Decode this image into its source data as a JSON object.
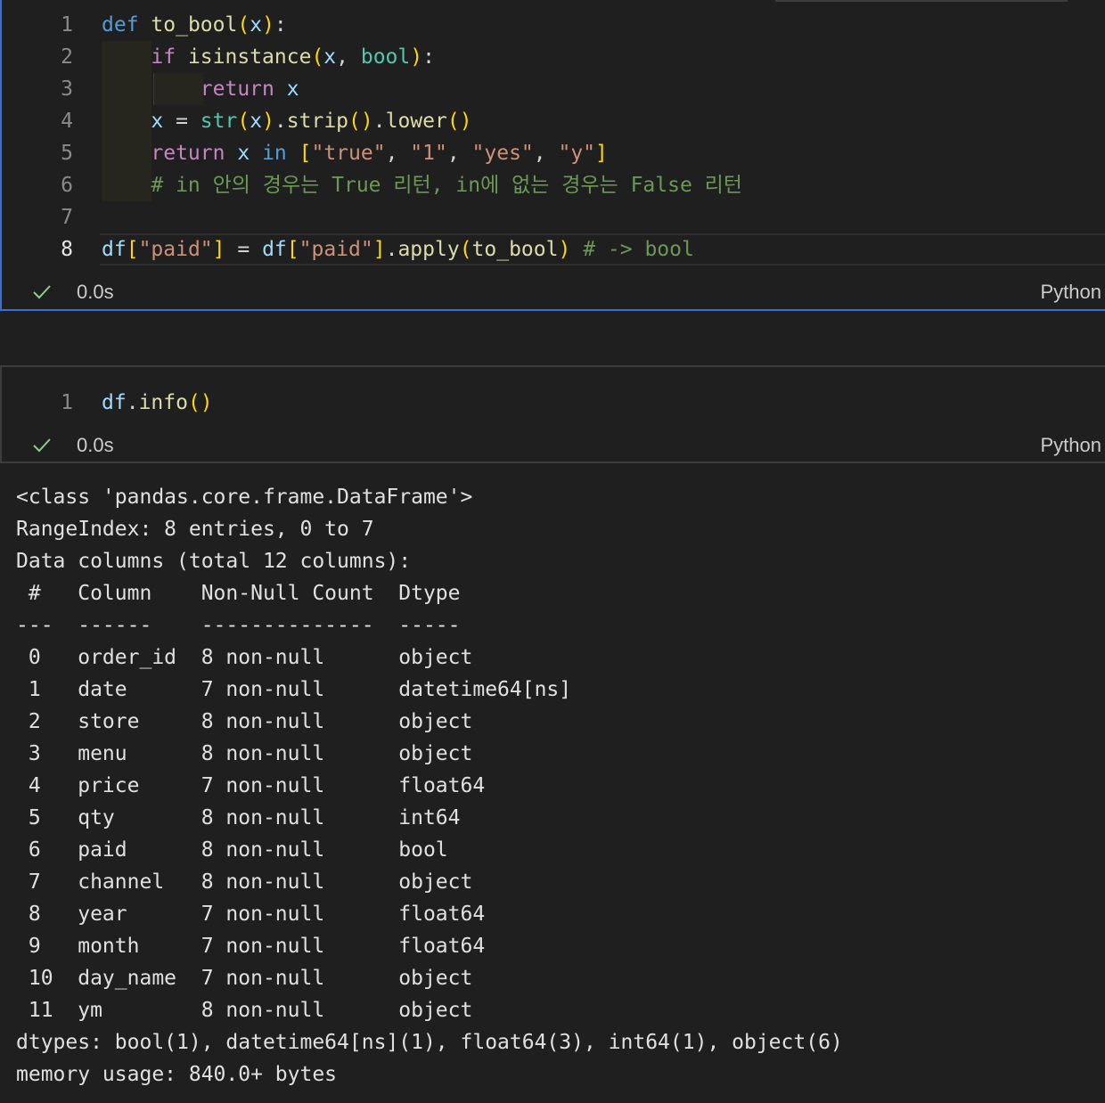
{
  "cell1": {
    "lines": [
      {
        "num": "1",
        "tokens": [
          {
            "t": "def",
            "c": "kw"
          },
          {
            "t": " ",
            "c": "op"
          },
          {
            "t": "to_bool",
            "c": "fn"
          },
          {
            "t": "(",
            "c": "br1"
          },
          {
            "t": "x",
            "c": "var"
          },
          {
            "t": ")",
            "c": "br1"
          },
          {
            "t": ":",
            "c": "op"
          }
        ]
      },
      {
        "num": "2",
        "tokens": [
          {
            "t": "    ",
            "c": "op"
          },
          {
            "t": "if",
            "c": "ctl"
          },
          {
            "t": " ",
            "c": "op"
          },
          {
            "t": "isinstance",
            "c": "fn"
          },
          {
            "t": "(",
            "c": "br1"
          },
          {
            "t": "x",
            "c": "var"
          },
          {
            "t": ", ",
            "c": "op"
          },
          {
            "t": "bool",
            "c": "cls"
          },
          {
            "t": ")",
            "c": "br1"
          },
          {
            "t": ":",
            "c": "op"
          }
        ]
      },
      {
        "num": "3",
        "tokens": [
          {
            "t": "        ",
            "c": "op"
          },
          {
            "t": "return",
            "c": "ctl"
          },
          {
            "t": " ",
            "c": "op"
          },
          {
            "t": "x",
            "c": "var"
          }
        ]
      },
      {
        "num": "4",
        "tokens": [
          {
            "t": "    ",
            "c": "op"
          },
          {
            "t": "x",
            "c": "var"
          },
          {
            "t": " = ",
            "c": "op"
          },
          {
            "t": "str",
            "c": "cls"
          },
          {
            "t": "(",
            "c": "br1"
          },
          {
            "t": "x",
            "c": "var"
          },
          {
            "t": ")",
            "c": "br1"
          },
          {
            "t": ".",
            "c": "op"
          },
          {
            "t": "strip",
            "c": "fn"
          },
          {
            "t": "()",
            "c": "br1"
          },
          {
            "t": ".",
            "c": "op"
          },
          {
            "t": "lower",
            "c": "fn"
          },
          {
            "t": "()",
            "c": "br1"
          }
        ]
      },
      {
        "num": "5",
        "tokens": [
          {
            "t": "    ",
            "c": "op"
          },
          {
            "t": "return",
            "c": "ctl"
          },
          {
            "t": " ",
            "c": "op"
          },
          {
            "t": "x",
            "c": "var"
          },
          {
            "t": " ",
            "c": "op"
          },
          {
            "t": "in",
            "c": "kw"
          },
          {
            "t": " ",
            "c": "op"
          },
          {
            "t": "[",
            "c": "br1"
          },
          {
            "t": "\"true\"",
            "c": "str"
          },
          {
            "t": ", ",
            "c": "op"
          },
          {
            "t": "\"1\"",
            "c": "str"
          },
          {
            "t": ", ",
            "c": "op"
          },
          {
            "t": "\"yes\"",
            "c": "str"
          },
          {
            "t": ", ",
            "c": "op"
          },
          {
            "t": "\"y\"",
            "c": "str"
          },
          {
            "t": "]",
            "c": "br1"
          }
        ]
      },
      {
        "num": "6",
        "tokens": [
          {
            "t": "    ",
            "c": "op"
          },
          {
            "t": "# in 안의 경우는 True 리턴, in에 없는 경우는 False 리턴",
            "c": "cmt"
          }
        ]
      },
      {
        "num": "7",
        "tokens": []
      },
      {
        "num": "8",
        "tokens": [
          {
            "t": "df",
            "c": "var"
          },
          {
            "t": "[",
            "c": "br1"
          },
          {
            "t": "\"paid\"",
            "c": "str"
          },
          {
            "t": "]",
            "c": "br1"
          },
          {
            "t": " = ",
            "c": "op"
          },
          {
            "t": "df",
            "c": "var"
          },
          {
            "t": "[",
            "c": "br1"
          },
          {
            "t": "\"paid\"",
            "c": "str"
          },
          {
            "t": "]",
            "c": "br1"
          },
          {
            "t": ".",
            "c": "op"
          },
          {
            "t": "apply",
            "c": "fn"
          },
          {
            "t": "(",
            "c": "br1"
          },
          {
            "t": "to_bool",
            "c": "fn"
          },
          {
            "t": ")",
            "c": "br1"
          },
          {
            "t": " ",
            "c": "op"
          },
          {
            "t": "# -> bool",
            "c": "cmt"
          }
        ]
      }
    ],
    "exec_time": "0.0s",
    "language": "Python"
  },
  "cell2": {
    "lines": [
      {
        "num": "1",
        "tokens": [
          {
            "t": "df",
            "c": "var"
          },
          {
            "t": ".",
            "c": "op"
          },
          {
            "t": "info",
            "c": "fn"
          },
          {
            "t": "()",
            "c": "br1"
          }
        ]
      }
    ],
    "exec_time": "0.0s",
    "language": "Python"
  },
  "output": {
    "header": [
      "<class 'pandas.core.frame.DataFrame'>",
      "RangeIndex: 8 entries, 0 to 7",
      "Data columns (total 12 columns):",
      " #   Column    Non-Null Count  Dtype",
      "---  ------    --------------  -----"
    ],
    "rows": [
      " 0   order_id  8 non-null      object",
      " 1   date      7 non-null      datetime64[ns]",
      " 2   store     8 non-null      object",
      " 3   menu      8 non-null      object",
      " 4   price     7 non-null      float64",
      " 5   qty       8 non-null      int64",
      " 6   paid      8 non-null      bool",
      " 7   channel   8 non-null      object",
      " 8   year      7 non-null      float64",
      " 9   month     7 non-null      float64",
      " 10  day_name  7 non-null      object",
      " 11  ym        8 non-null      object"
    ],
    "footer": [
      "dtypes: bool(1), datetime64[ns](1), float64(3), int64(1), object(6)",
      "memory usage: 840.0+ bytes"
    ]
  },
  "icons": {
    "check": "check-icon"
  },
  "colors": {
    "focus_border": "#3b6fd4",
    "check": "#89d185",
    "background": "#1f1f1f"
  }
}
